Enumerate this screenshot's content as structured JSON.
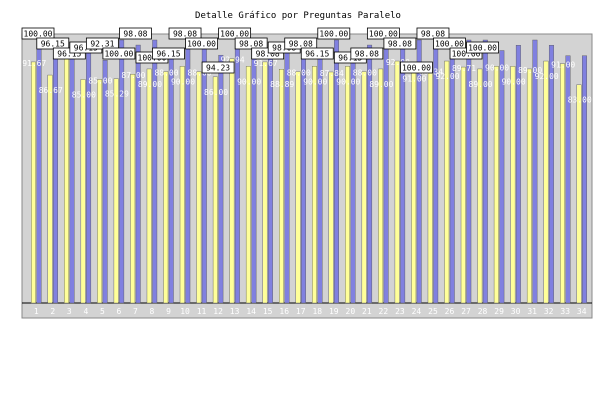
{
  "chart_data": {
    "type": "bar",
    "title": "Detalle Gráfico por Preguntas Paralelo",
    "xlabel": "",
    "ylabel": "",
    "ylim": [
      0,
      100
    ],
    "yticks": [
      25,
      50,
      75,
      100
    ],
    "grid": false,
    "legend": "none",
    "categories": [
      "1",
      "2",
      "3",
      "4",
      "5",
      "6",
      "7",
      "8",
      "9",
      "10",
      "11",
      "12",
      "13",
      "14",
      "15",
      "16",
      "17",
      "18",
      "19",
      "20",
      "21",
      "22",
      "23",
      "24",
      "25",
      "26",
      "27",
      "28",
      "29",
      "30",
      "31",
      "32",
      "33",
      "34"
    ],
    "series": [
      {
        "values": [
          100.0,
          96.15,
          96.15,
          96.15,
          92.31,
          100.0,
          98.08,
          100.0,
          96.15,
          98.08,
          100.0,
          94.23,
          100.0,
          98.08,
          98.08,
          98.08,
          98.08,
          96.15,
          100.0,
          96.15,
          98.08,
          100.0,
          98.08,
          100.0,
          98.08,
          100.0,
          100.0,
          100.0,
          96.0,
          98.0,
          100.0,
          98.0,
          94.0,
          94.0
        ]
      },
      {
        "values": [
          91.67,
          86.67,
          97.27,
          85.0,
          85.0,
          85.29,
          87.0,
          89.0,
          88.0,
          90.0,
          88.0,
          86.0,
          92.94,
          90.0,
          91.67,
          88.89,
          88.0,
          90.0,
          87.84,
          90.0,
          88.0,
          89.0,
          92.0,
          91.0,
          88.34,
          92.0,
          89.71,
          89.0,
          90.0,
          90.0,
          89.0,
          92.0,
          91.0,
          83.0
        ]
      }
    ],
    "value_boxes": [
      {
        "index": 0,
        "text": "100.00"
      },
      {
        "index": 1,
        "text": "96.15"
      },
      {
        "index": 2,
        "text": "96.15"
      },
      {
        "index": 3,
        "text": "96.15"
      },
      {
        "index": 4,
        "text": "92.31"
      },
      {
        "index": 5,
        "text": "100.00"
      },
      {
        "index": 6,
        "text": "98.08"
      },
      {
        "index": 7,
        "text": "100.00"
      },
      {
        "index": 8,
        "text": "96.15"
      },
      {
        "index": 9,
        "text": "98.08"
      },
      {
        "index": 10,
        "text": "100.00"
      },
      {
        "index": 11,
        "text": "94.23"
      },
      {
        "index": 12,
        "text": "100.00"
      },
      {
        "index": 13,
        "text": "98.08"
      },
      {
        "index": 14,
        "text": "98.08"
      },
      {
        "index": 15,
        "text": "98.08"
      },
      {
        "index": 16,
        "text": "98.08"
      },
      {
        "index": 17,
        "text": "96.15"
      },
      {
        "index": 18,
        "text": "100.00"
      },
      {
        "index": 19,
        "text": "96.15"
      },
      {
        "index": 20,
        "text": "98.08"
      },
      {
        "index": 21,
        "text": "100.00"
      },
      {
        "index": 22,
        "text": "98.08"
      },
      {
        "index": 23,
        "text": "100.00"
      },
      {
        "index": 24,
        "text": "98.08"
      },
      {
        "index": 25,
        "text": "100.00"
      },
      {
        "index": 26,
        "text": "100.00"
      },
      {
        "index": 27,
        "text": "100.00"
      }
    ],
    "colors": {
      "series1": "#8080e0",
      "series2": "#ffff99",
      "plot_bg": "#d3d3d3",
      "axis": "#000000"
    }
  }
}
